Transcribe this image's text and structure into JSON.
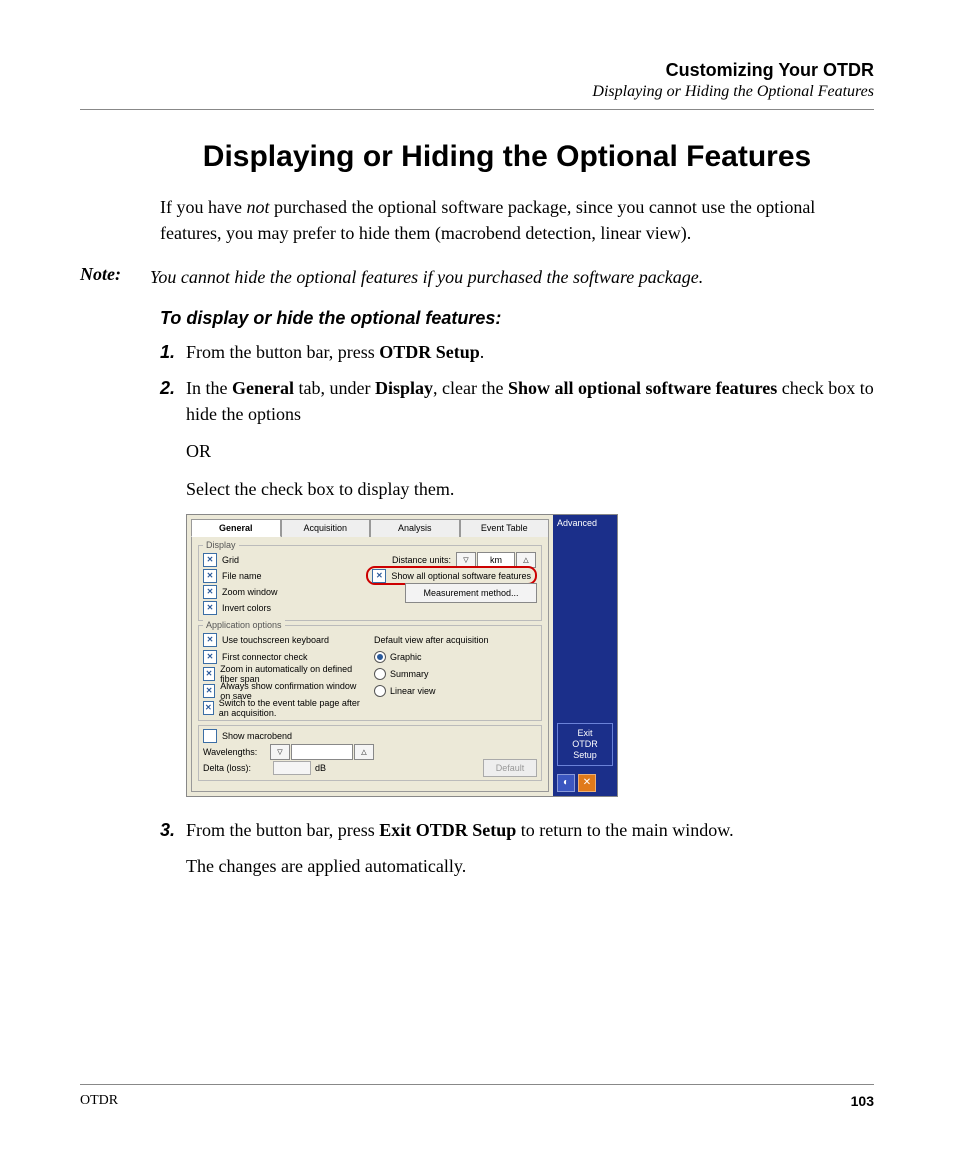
{
  "header": {
    "title": "Customizing Your OTDR",
    "subtitle": "Displaying or Hiding the Optional Features"
  },
  "main_heading": "Displaying or Hiding the Optional Features",
  "intro": {
    "prefix": "If you have ",
    "em": "not",
    "suffix": " purchased the optional software package, since you cannot use the optional features, you may prefer to hide them (macrobend detection, linear view)."
  },
  "note": {
    "label": "Note:",
    "text": "You cannot hide the optional features if you purchased the software package."
  },
  "procedure_heading": "To display or hide the optional features:",
  "steps": {
    "s1": {
      "num": "1.",
      "t1": "From the button bar, press ",
      "b1": "OTDR Setup",
      "t2": "."
    },
    "s2": {
      "num": "2.",
      "t1": "In the ",
      "b1": "General",
      "t2": " tab, under ",
      "b2": "Display",
      "t3": ", clear the ",
      "b3": "Show all optional software features",
      "t4": " check box to hide the options",
      "or": "OR",
      "select_line": "Select the check box to display them."
    },
    "s3": {
      "num": "3.",
      "t1": "From the button bar, press ",
      "b1": "Exit OTDR Setup",
      "t2": " to return to the main window.",
      "applied": "The changes are applied automatically."
    }
  },
  "screenshot": {
    "tabs": {
      "general": "General",
      "acquisition": "Acquisition",
      "analysis": "Analysis",
      "event_table": "Event Table"
    },
    "groups": {
      "display": "Display",
      "app_options": "Application options"
    },
    "display": {
      "grid": "Grid",
      "file_name": "File name",
      "zoom_window": "Zoom window",
      "invert_colors": "Invert colors",
      "distance_units": "Distance units:",
      "km": "km",
      "show_all": "Show all optional software features",
      "meas_method": "Measurement method..."
    },
    "app": {
      "use_touch": "Use touchscreen keyboard",
      "first_conn": "First connector check",
      "zoom_auto": "Zoom in automatically on defined fiber span",
      "always_confirm": "Always show confirmation window on save",
      "switch_event": "Switch to the event table page after an acquisition.",
      "default_view": "Default view after acquisition",
      "graphic": "Graphic",
      "summary": "Summary",
      "linear": "Linear view"
    },
    "macro": {
      "show_macrobend": "Show macrobend",
      "wavelengths": "Wavelengths:",
      "delta": "Delta (loss):",
      "db": "dB",
      "default_btn": "Default"
    },
    "side": {
      "advanced": "Advanced",
      "exit_line1": "Exit",
      "exit_line2": "OTDR Setup"
    }
  },
  "footer": {
    "left": "OTDR",
    "page": "103"
  }
}
